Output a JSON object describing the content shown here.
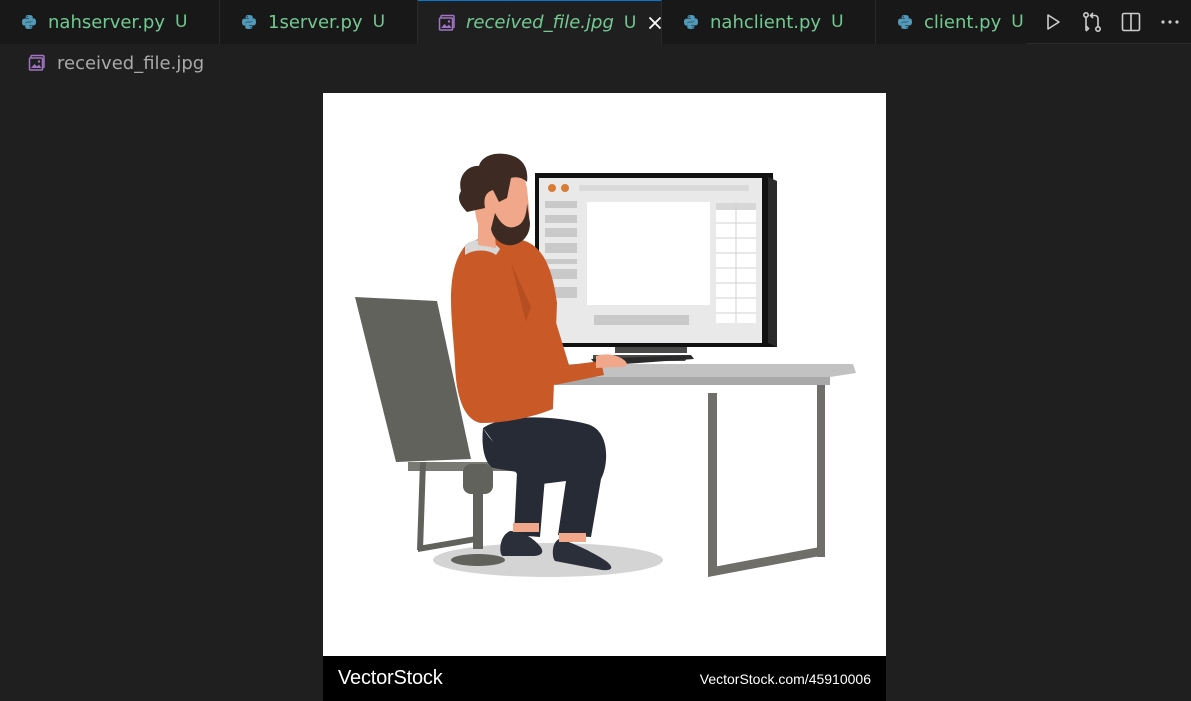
{
  "tabs": [
    {
      "label": "nahserver.py",
      "status": "U",
      "icon": "python-icon",
      "active": false
    },
    {
      "label": "1server.py",
      "status": "U",
      "icon": "python-icon",
      "active": false
    },
    {
      "label": "received_file.jpg",
      "status": "U",
      "icon": "image-icon",
      "active": true
    },
    {
      "label": "nahclient.py",
      "status": "U",
      "icon": "python-icon",
      "active": false
    },
    {
      "label": "client.py",
      "status": "U",
      "icon": "python-icon",
      "active": false
    }
  ],
  "editor_actions": [
    "run-icon",
    "compare-changes-icon",
    "split-editor-icon",
    "more-actions-icon"
  ],
  "breadcrumb": {
    "file": "received_file.jpg",
    "icon": "image-icon"
  },
  "image": {
    "watermark_brand": "VectorStock",
    "watermark_url": "VectorStock.com/45910006"
  },
  "colors": {
    "untracked_green": "#73c991",
    "python_blue": "#519aba",
    "image_purple": "#a074c4",
    "editor_bg": "#1f1f1f",
    "tabbar_bg": "#181818"
  }
}
